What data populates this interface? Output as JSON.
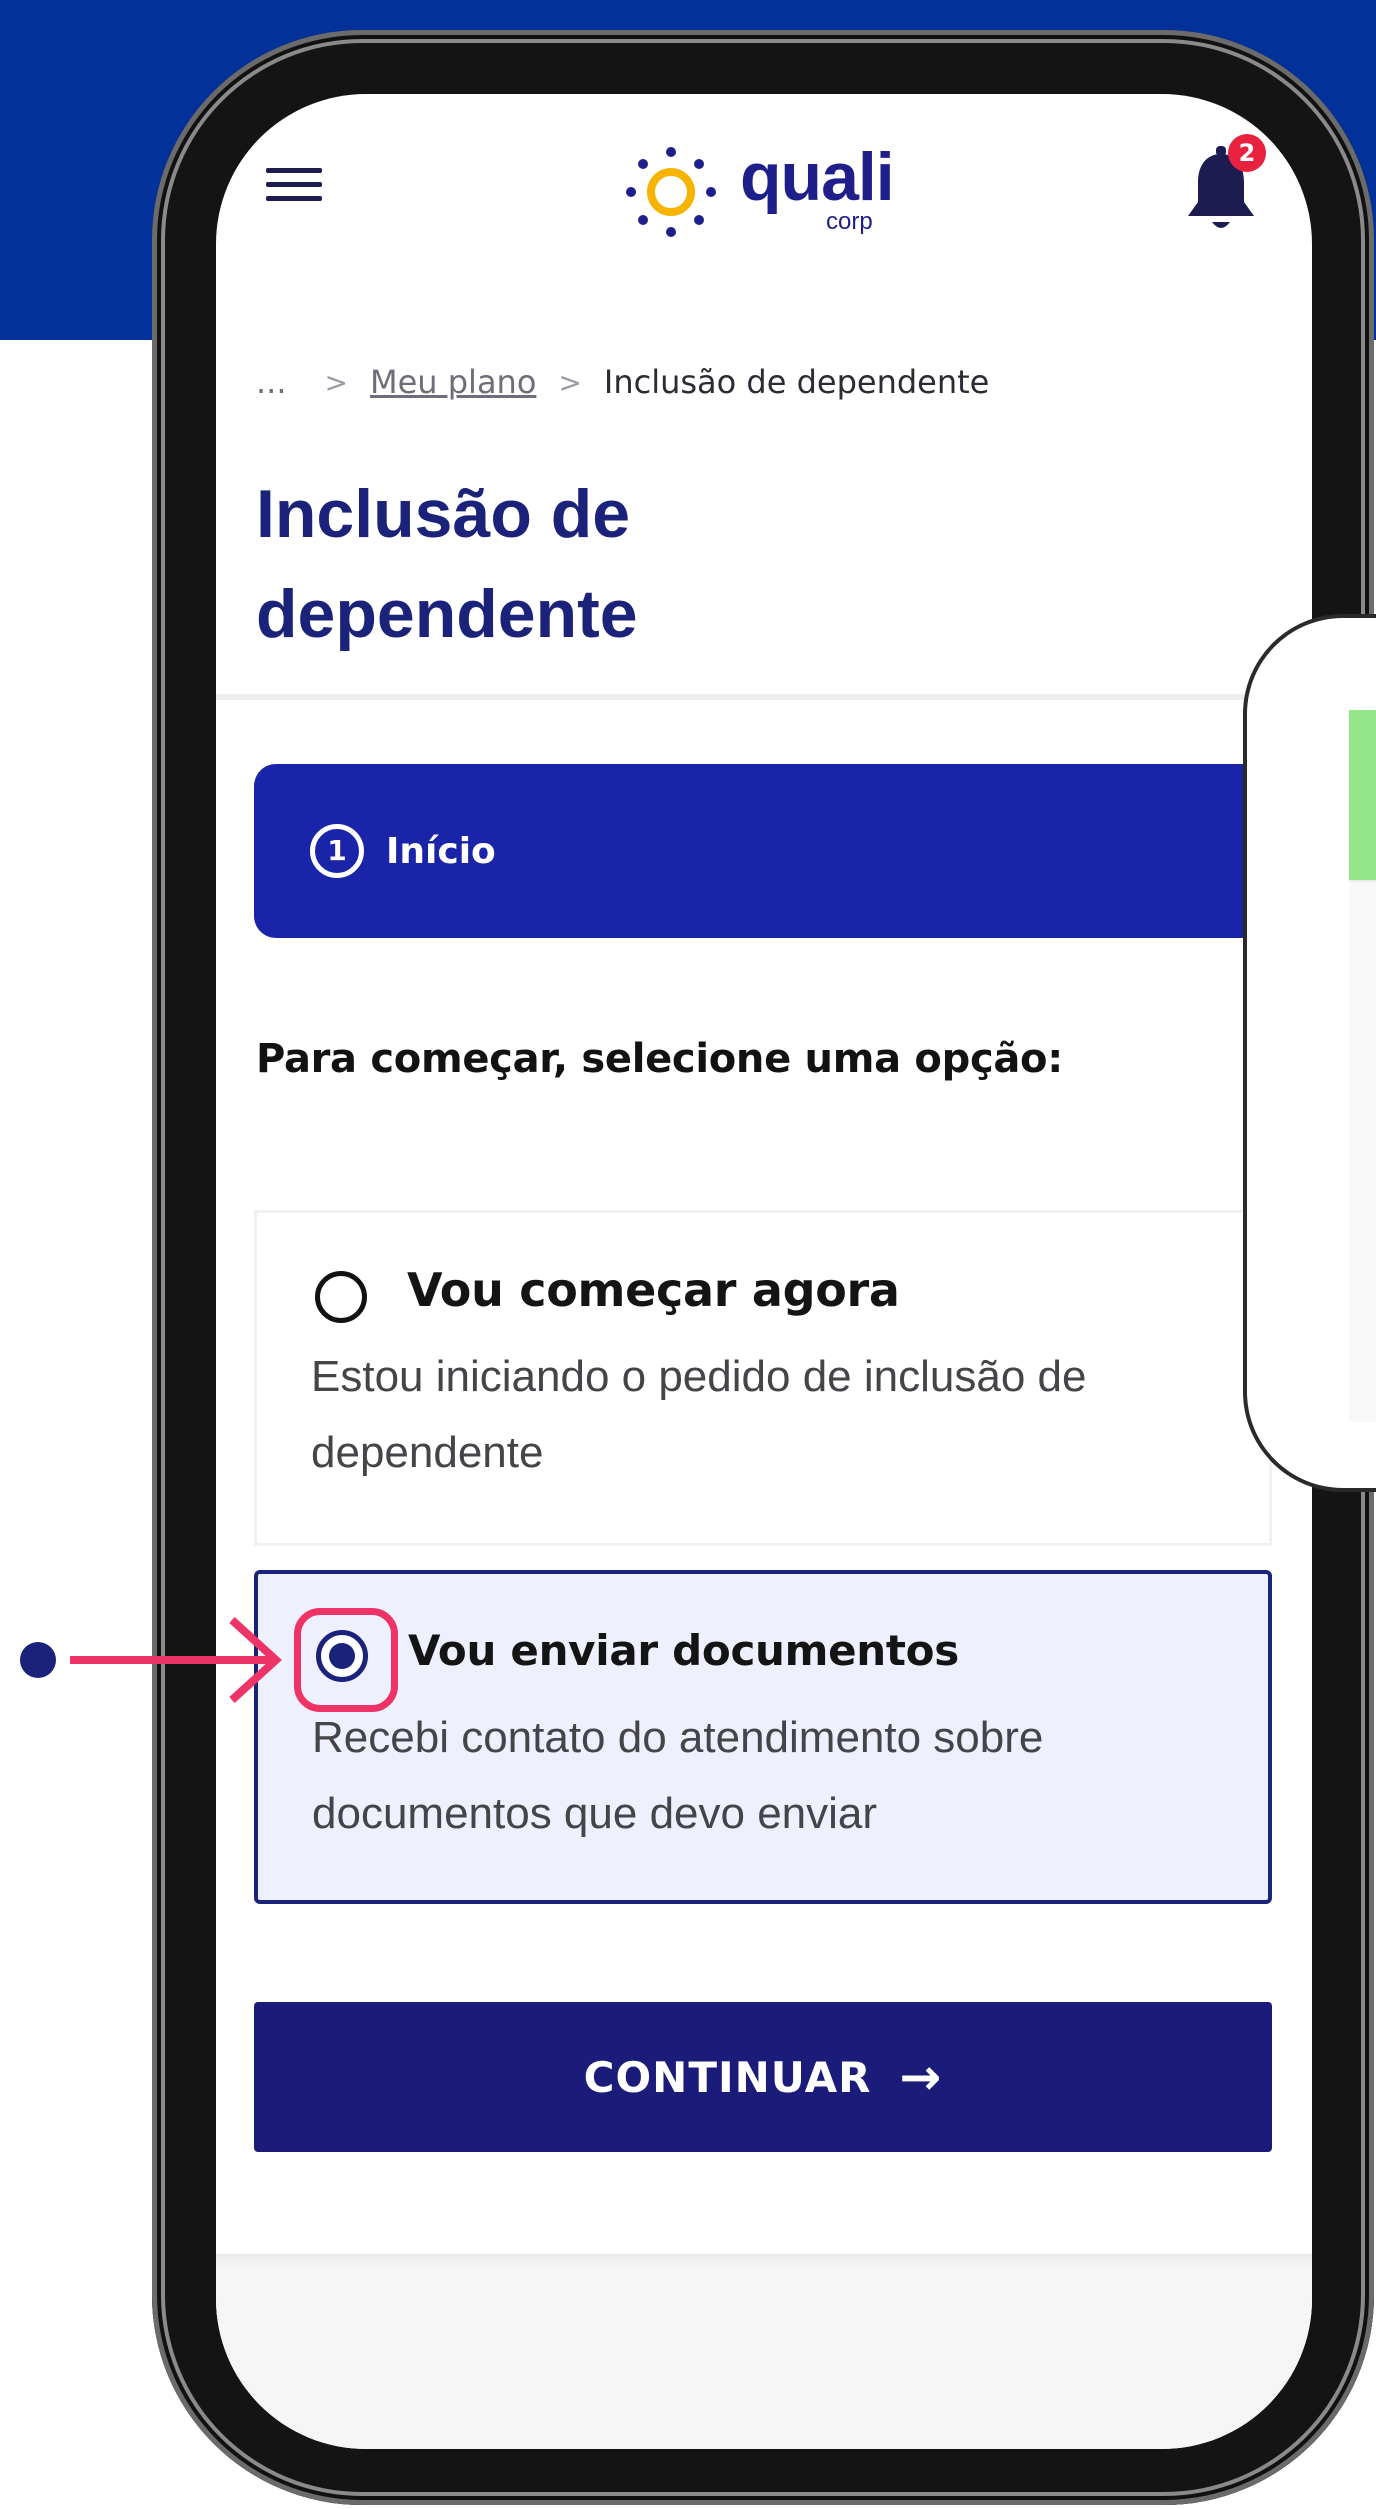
{
  "colors": {
    "background_band": "#02319a",
    "primary": "#1b2279",
    "step_banner": "#1a24a8",
    "accent_highlight": "#ee3366",
    "selected_bg": "#eef0fd",
    "badge": "#e8213f",
    "button": "#1b1b7a"
  },
  "header": {
    "logo_text": "quali",
    "logo_subtext": "corp",
    "menu_icon": "hamburger-icon",
    "notification_icon": "bell-icon",
    "notification_count": "2"
  },
  "breadcrumb": {
    "ellipsis": "...",
    "separator": ">",
    "items": [
      "Meu plano",
      "Inclusão de dependente"
    ]
  },
  "page": {
    "title": "Inclusão de dependente"
  },
  "step": {
    "number": "1",
    "label": "Início"
  },
  "prompt": "Para começar, selecione uma opção:",
  "options": [
    {
      "title": "Vou começar agora",
      "description": "Estou iniciando o pedido de inclusão de dependente",
      "selected": false
    },
    {
      "title": "Vou enviar documentos",
      "description": "Recebi contato do atendimento sobre documentos que devo enviar",
      "selected": true
    }
  ],
  "continue_button": {
    "label": "CONTINUAR",
    "icon": "arrow-right-icon"
  }
}
